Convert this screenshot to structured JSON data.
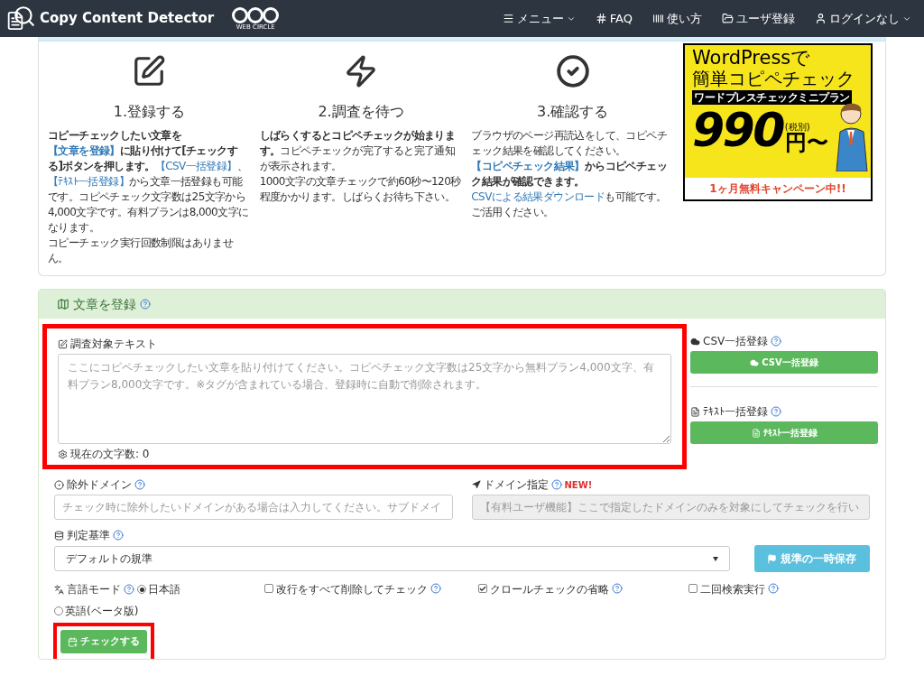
{
  "navbar": {
    "brand": "Copy Content Detector",
    "partner_logo": "WEB CIRCLE",
    "menu": [
      {
        "label": "メニュー",
        "caret": true
      },
      {
        "label": "FAQ",
        "caret": false
      },
      {
        "label": "使い方",
        "caret": false
      },
      {
        "label": "ユーザ登録",
        "caret": false
      },
      {
        "label": "ログインなし",
        "caret": true
      }
    ]
  },
  "steps": [
    {
      "title": "1.登録する",
      "paragraphs": [
        [
          {
            "kind": "bold",
            "text": "コピーチェックしたい文章を"
          },
          {
            "kind": "bold_link",
            "text": "【文章を登録】"
          },
          {
            "kind": "bold",
            "text": "に貼り付けて[チェックする]ボタンを押します。"
          },
          {
            "kind": "link",
            "text": "【CSV一括登録】"
          },
          {
            "kind": "plain",
            "text": "、"
          },
          {
            "kind": "link",
            "text": "【ﾃｷｽﾄ一括登録】"
          },
          {
            "kind": "plain",
            "text": "から文章一括登録も可能です。コピペチェック文字数は25文字から4,000文字です。有料プランは8,000文字になります。"
          }
        ],
        [
          {
            "kind": "plain",
            "text": "コピーチェック実行回数制限はありません。"
          }
        ]
      ]
    },
    {
      "title": "2.調査を待つ",
      "paragraphs": [
        [
          {
            "kind": "bold",
            "text": "しばらくするとコピペチェックが始まります。"
          },
          {
            "kind": "plain",
            "text": "コピペチェックが完了すると完了通知が表示されます。"
          }
        ],
        [
          {
            "kind": "plain",
            "text": "1000文字の文章チェックで約60秒〜120秒程度かかります。しばらくお待ち下さい。"
          }
        ]
      ]
    },
    {
      "title": "3.確認する",
      "paragraphs": [
        [
          {
            "kind": "plain",
            "text": "ブラウザのページ再読込をして、コピペチェック結果を確認してください。"
          },
          {
            "kind": "bold_link",
            "text": "【コピペチェック結果】"
          },
          {
            "kind": "bold",
            "text": "からコピペチェック結果が確認できます。"
          },
          {
            "kind": "link",
            "text": "CSVによる結果ダウンロード"
          },
          {
            "kind": "plain",
            "text": "も可能です。ご活用ください。"
          }
        ]
      ]
    }
  ],
  "ad": {
    "line1": "WordPressで",
    "line2": "簡単コピペチェック",
    "plan": "ワードプレスチェックミニプラン",
    "price": "990",
    "tax": "(税別)",
    "unit": "円〜",
    "campaign": "1ヶ月無料キャンペーン中!!"
  },
  "register": {
    "title": "文章を登録",
    "text_area": {
      "label": "調査対象テキスト",
      "placeholder": "ここにコピペチェックしたい文章を貼り付けてください。コピペチェック文字数は25文字から無料プラン4,000文字、有料プラン8,000文字です。※タグが含まれている場合、登録時に自動で削除されます。",
      "counter": "現在の文字数: 0",
      "highlighted": true
    },
    "bulk": [
      {
        "label": "CSV一括登録",
        "button": "CSV一括登録"
      },
      {
        "label": "ﾃｷｽﾄ一括登録",
        "button": "ﾃｷｽﾄ一括登録"
      }
    ],
    "exclude_domain": {
      "label": "除外ドメイン",
      "placeholder": "チェック時に除外したいドメインがある場合は入力してください。サブドメイ"
    },
    "domain_spec": {
      "label": "ドメイン指定",
      "badge": "NEW!",
      "placeholder": "【有料ユーザ機能】ここで指定したドメインのみを対象にしてチェックを行い",
      "disabled": true
    },
    "criterion": {
      "label": "判定基準",
      "value": "デフォルトの規準",
      "save_button": "規準の一時保存"
    },
    "language": {
      "label": "言語モード",
      "options": [
        {
          "label": "日本語",
          "selected": true
        },
        {
          "label": "英語(ベータ版)",
          "selected": false
        }
      ]
    },
    "checkboxes": [
      {
        "label": "改行をすべて削除してチェック",
        "checked": false
      },
      {
        "label": "クロールチェックの省略",
        "checked": true
      },
      {
        "label": "二回検索実行",
        "checked": false
      }
    ],
    "submit": {
      "label": "チェックする",
      "highlighted": true
    }
  }
}
